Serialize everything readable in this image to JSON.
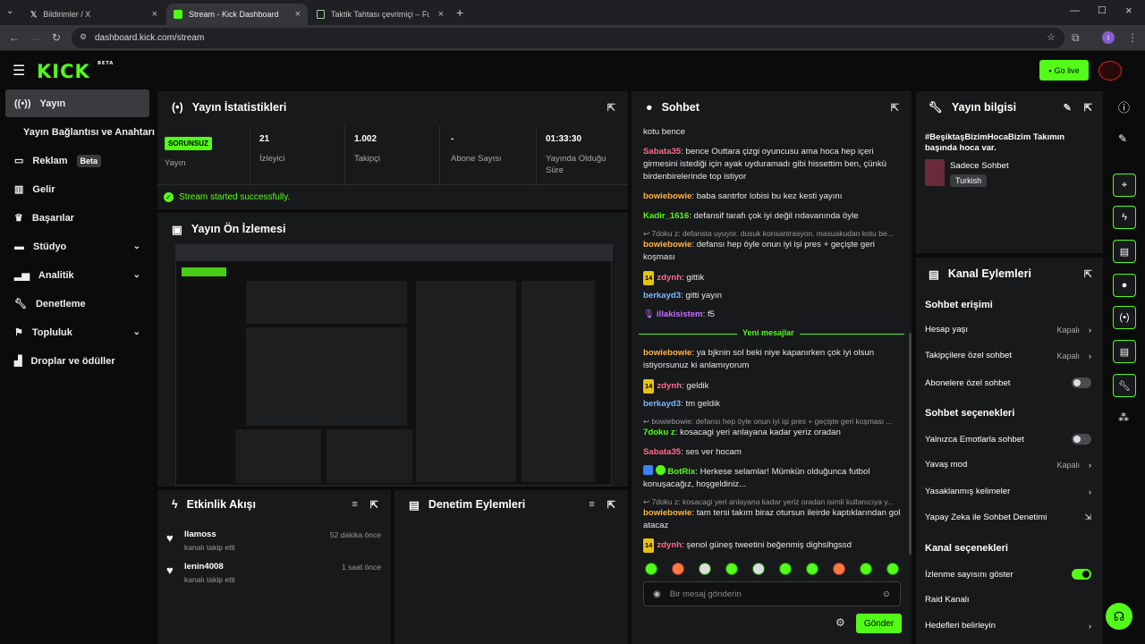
{
  "browser": {
    "tabs": [
      {
        "title": "Bildirimler / X"
      },
      {
        "title": "Stream - Kick Dashboard"
      },
      {
        "title": "Taktik Tahtası çevrimiçi – Futbol"
      }
    ],
    "url": "dashboard.kick.com/stream",
    "profile_initial": "I"
  },
  "topbar": {
    "logo": "KICK",
    "logo_sup": "BETA",
    "go_live": "Go live"
  },
  "sidebar": {
    "items": [
      {
        "label": "Yayın"
      },
      {
        "label": "Yayın Bağlantısı ve Anahtarı"
      },
      {
        "label": "Reklam",
        "badge": "Beta"
      },
      {
        "label": "Gelir"
      },
      {
        "label": "Başarılar"
      },
      {
        "label": "Stüdyo"
      },
      {
        "label": "Analitik"
      },
      {
        "label": "Denetleme"
      },
      {
        "label": "Topluluk"
      },
      {
        "label": "Droplar ve ödüller"
      }
    ]
  },
  "stats": {
    "title": "Yayın İstatistikleri",
    "status_badge": "SORUNSUZ",
    "status_label": "Yayın",
    "cells": [
      {
        "value": "21",
        "label": "İzleyici"
      },
      {
        "value": "1.002",
        "label": "Takipçi"
      },
      {
        "value": "-",
        "label": "Abone Sayısı"
      },
      {
        "value": "01:33:30",
        "label": "Yayında Olduğu Süre"
      }
    ],
    "success_msg": "Stream started successfully."
  },
  "preview": {
    "title": "Yayın Ön İzlemesi"
  },
  "activity": {
    "title": "Etkinlik Akışı",
    "items": [
      {
        "user": "llamoss",
        "action": "kanalı takip etti",
        "time": "52 dakika önce"
      },
      {
        "user": "lenin4008",
        "action": "kanalı takip etti",
        "time": "1 saat önce"
      }
    ]
  },
  "moderation": {
    "title": "Denetim Eylemleri"
  },
  "chat": {
    "title": "Sohbet",
    "messages": [
      {
        "user": "",
        "text": "kotu bence",
        "color": "#e8e8e8"
      },
      {
        "user": "Sabata35",
        "text": "bence Outtara çizgi oyuncusu ama hoca hep içeri girmesini istediği için ayak uyduramadı gibi hissettim ben, çünkü birdenbirelerinde top istiyor",
        "color": "#ff6b8a"
      },
      {
        "user": "bowiebowie",
        "text": "baba santrfor lobisi bu kez kesti yayını",
        "color": "#ffb347"
      },
      {
        "user": "Kadir_1616",
        "text": "defansif tarafı çok iyi değil rıdavanında öyle",
        "color": "#53fc18"
      },
      {
        "reply": "7doku z: defansta uyuyor. dusuk konsantrasyon. masuakudan kotu be..."
      },
      {
        "user": "bowiebowie",
        "text": "defansı hep öyle onun iyi işi pres + geçişte geri koşması",
        "color": "#ffb347"
      },
      {
        "user": "zdynh",
        "text": "gittik",
        "color": "#ff6b8a",
        "sub": "14"
      },
      {
        "user": "berkayd3",
        "text": "gitti yayın",
        "color": "#7ab8ff"
      },
      {
        "user": "illakisistem",
        "text": "f5",
        "color": "#c070ff"
      },
      {
        "divider": "Yeni mesajlar"
      },
      {
        "user": "bowiebowie",
        "text": "ya bjknin sol beki niye kapanırken çok iyi olsun istiyorsunuz ki anlamıyorum",
        "color": "#ffb347"
      },
      {
        "user": "zdynh",
        "text": "geldik",
        "color": "#ff6b8a",
        "sub": "14"
      },
      {
        "user": "berkayd3",
        "text": "tm geldik",
        "color": "#7ab8ff"
      },
      {
        "reply": "bowiebowie: defansı hep öyle onun iyi işi pres + geçişte geri koşması ..."
      },
      {
        "user": "7doku z",
        "text": "kosacagi yeri anlayana kadar yeriz oradan",
        "color": "#53fc18"
      },
      {
        "user": "Sabata35",
        "text": "ses ver hocam",
        "color": "#ff6b8a"
      },
      {
        "user": "BotRix",
        "text": "Herkese selamlar! Mümkün olduğunca futbol konuşacağız, hoşgeldiniz...",
        "color": "#53fc18"
      },
      {
        "reply": "7doku z: kosacagi yeri anlayana kadar yeriz oradan isimli kullanıcıya y..."
      },
      {
        "user": "bowiebowie",
        "text": "tam tersi takım biraz otursun ileirde kaptıklarından gol atacaz",
        "color": "#ffb347"
      },
      {
        "user": "zdynh",
        "text": "şenol güneş tweetini beğenmiş dighslhgssd",
        "color": "#ff6b8a",
        "sub": "14"
      }
    ],
    "input_placeholder": "Bir mesaj gönderin",
    "send_label": "Gönder"
  },
  "stream_info": {
    "title": "Yayın bilgisi",
    "stream_title": "#BeşiktaşBizimHocaBizim Takımın başında hoca var.",
    "category": "Sadece Sohbet",
    "tag": "Turkish"
  },
  "channel_actions": {
    "title": "Kanal Eylemleri",
    "chat_access": "Sohbet erişimi",
    "account_age": {
      "label": "Hesap yaşı",
      "value": "Kapalı"
    },
    "followers_only": {
      "label": "Takipçilere özel sohbet",
      "value": "Kapalı"
    },
    "subs_only": {
      "label": "Abonelere özel sohbet"
    },
    "chat_options": "Sohbet seçenekleri",
    "emote_only": {
      "label": "Yalnızca Emotlarla sohbet"
    },
    "slow_mode": {
      "label": "Yavaş mod",
      "value": "Kapalı"
    },
    "banned_words": {
      "label": "Yasaklanmış kelimeler"
    },
    "ai_moderation": {
      "label": "Yapay Zeka ile Sohbet Denetimi"
    },
    "channel_options": "Kanal seçenekleri",
    "show_viewers": {
      "label": "İzlenme sayısını göster"
    },
    "raid": {
      "label": "Raid Kanalı"
    },
    "goals": {
      "label": "Hedefleri belirleyin"
    }
  },
  "colors": {
    "accent": "#53fc18",
    "panel": "#18191b",
    "bg": "#0b0b0c"
  }
}
